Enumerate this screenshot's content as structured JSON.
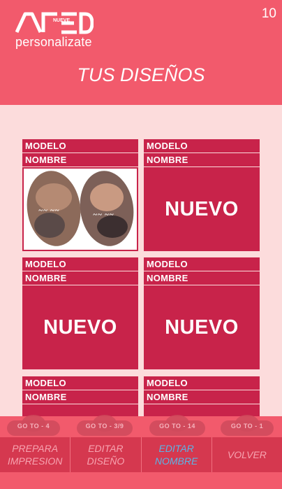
{
  "header": {
    "logo_word": "NUEVE",
    "logo_tagline": "personalizate",
    "counter": "10",
    "title": "TUS DISEÑOS"
  },
  "cards": [
    {
      "modelo": "MODELO",
      "nombre": "NOMBRE",
      "content": "",
      "has_image": true
    },
    {
      "modelo": "MODELO",
      "nombre": "NOMBRE",
      "content": "NUEVO",
      "has_image": false
    },
    {
      "modelo": "MODELO",
      "nombre": "NOMBRE",
      "content": "NUEVO",
      "has_image": false
    },
    {
      "modelo": "MODELO",
      "nombre": "NOMBRE",
      "content": "NUEVO",
      "has_image": false
    },
    {
      "modelo": "MODELO",
      "nombre": "NOMBRE",
      "content": "",
      "has_image": false
    },
    {
      "modelo": "MODELO",
      "nombre": "NOMBRE",
      "content": "",
      "has_image": false
    }
  ],
  "goto": [
    "GO TO  -  4",
    "GO TO  -  3/9",
    "GO TO  -  14",
    "GO TO  -  1"
  ],
  "nav": {
    "prepara": "PREPARA IMPRESION",
    "editar_diseno": "EDITAR DISEÑO",
    "editar_nombre": "EDITAR NOMBRE",
    "volver": "VOLVER"
  },
  "colors": {
    "header_bg": "#f25a6c",
    "card": "#c8234a",
    "page_bg": "#fcdcdc",
    "active_nav": "#5bb4e6"
  }
}
